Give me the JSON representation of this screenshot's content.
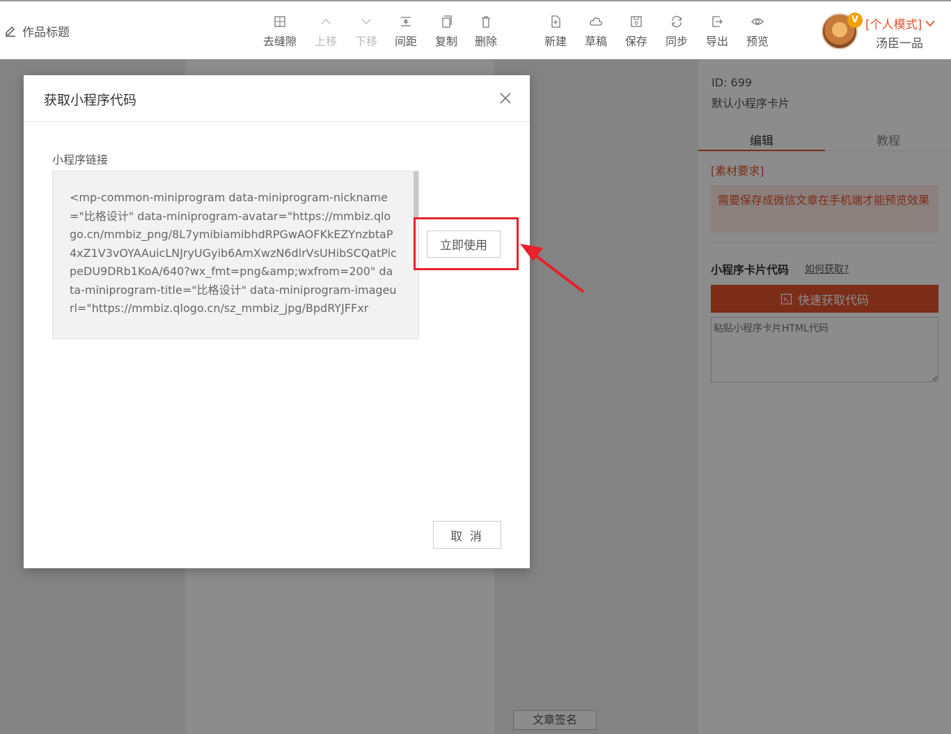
{
  "topbar": {
    "title": "作品标题",
    "items": [
      {
        "id": "remove-gap",
        "label": "去缝隙",
        "disabled": false
      },
      {
        "id": "move-up",
        "label": "上移",
        "disabled": true
      },
      {
        "id": "move-down",
        "label": "下移",
        "disabled": true
      },
      {
        "id": "spacing",
        "label": "间距",
        "disabled": false
      },
      {
        "id": "copy",
        "label": "复制",
        "disabled": false
      },
      {
        "id": "delete",
        "label": "删除",
        "disabled": false
      },
      {
        "id": "new",
        "label": "新建",
        "disabled": false
      },
      {
        "id": "draft",
        "label": "草稿",
        "disabled": false
      },
      {
        "id": "save",
        "label": "保存",
        "disabled": false
      },
      {
        "id": "sync",
        "label": "同步",
        "disabled": false
      },
      {
        "id": "export",
        "label": "导出",
        "disabled": false
      },
      {
        "id": "preview",
        "label": "预览",
        "disabled": false
      }
    ],
    "vip_badge": "V",
    "mode": "[个人模式]",
    "username": "汤臣一品"
  },
  "panel": {
    "id_text": "ID: 699",
    "name": "默认小程序卡片",
    "tabs": [
      "编辑",
      "教程"
    ],
    "requirements_title": "[素材要求]",
    "requirements_text": "需要保存成微信文章在手机端才能预览效果",
    "code_title": "小程序卡片代码",
    "how_link": "如何获取?",
    "quick_button": "快速获取代码",
    "paste_placeholder": "粘贴小程序卡片HTML代码"
  },
  "canvas": {
    "sign_button": "文章签名"
  },
  "modal": {
    "title": "获取小程序代码",
    "field_label": "小程序链接",
    "code_value": "<mp-common-miniprogram data-miniprogram-nickname=\"比格设计\" data-miniprogram-avatar=\"https://mmbiz.qlogo.cn/mmbiz_png/8L7ymibiamibhdRPGwAOFKkEZYnzbtaP4xZ1V3vOYAAuicLNJryUGyib6AmXwzN6dlrVsUHibSCQatPicpeDU9DRb1KoA/640?wx_fmt=png&amp;wxfrom=200\" data-miniprogram-title=\"比格设计\" data-miniprogram-imageurl=\"https://mmbiz.qlogo.cn/sz_mmbiz_jpg/BpdRYJFFxr",
    "use_button": "立即使用",
    "cancel_button": "取 消"
  },
  "colors": {
    "accent": "#e2522d",
    "highlight": "#e8212a"
  }
}
